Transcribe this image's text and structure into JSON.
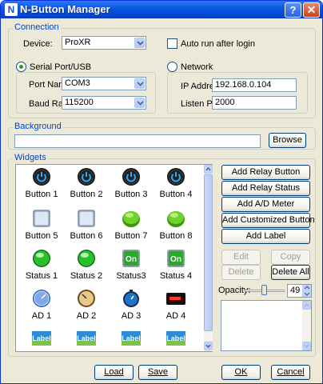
{
  "window": {
    "title": "N-Button Manager",
    "icon_letter": "N"
  },
  "connection": {
    "title": "Connection",
    "device_label": "Device:",
    "device_value": "ProXR",
    "auto_run_label": "Auto run after login",
    "serial_label": "Serial Port/USB",
    "network_label": "Network",
    "port_name_label": "Port Name:",
    "port_name_value": "COM3",
    "baud_rate_label": "Baud Rate:",
    "baud_rate_value": "115200",
    "ip_label": "IP Address:",
    "ip_value": "192.168.0.104",
    "listen_port_label": "Listen Port:",
    "listen_port_value": "2000"
  },
  "background": {
    "title": "Background",
    "path_value": "",
    "browse_label": "Browse"
  },
  "widgets": {
    "title": "Widgets",
    "items": [
      {
        "label": "Button 1",
        "icon": "power-button-icon"
      },
      {
        "label": "Button 2",
        "icon": "power-button-icon"
      },
      {
        "label": "Button 3",
        "icon": "power-button-icon"
      },
      {
        "label": "Button 4",
        "icon": "power-button-icon"
      },
      {
        "label": "Button 5",
        "icon": "square-button-icon"
      },
      {
        "label": "Button 6",
        "icon": "square-button-icon"
      },
      {
        "label": "Button 7",
        "icon": "green-round-button-icon"
      },
      {
        "label": "Button 8",
        "icon": "green-round-button-icon"
      },
      {
        "label": "Status 1",
        "icon": "green-led-icon"
      },
      {
        "label": "Status 2",
        "icon": "green-led-icon"
      },
      {
        "label": "Status3",
        "icon": "on-status-icon"
      },
      {
        "label": "Status 4",
        "icon": "on-status-icon"
      },
      {
        "label": "AD 1",
        "icon": "blue-meter-icon"
      },
      {
        "label": "AD 2",
        "icon": "gauge-meter-icon"
      },
      {
        "label": "AD 3",
        "icon": "stopwatch-meter-icon"
      },
      {
        "label": "AD 4",
        "icon": "digital-meter-icon"
      },
      {
        "label": "",
        "icon": "label-icon"
      },
      {
        "label": "",
        "icon": "label-icon"
      },
      {
        "label": "",
        "icon": "label-icon"
      },
      {
        "label": "",
        "icon": "label-icon"
      }
    ],
    "on_text": "On",
    "label_icon_text": "Label",
    "add_relay_button": "Add Relay Button",
    "add_relay_status": "Add Relay Status",
    "add_ad_meter": "Add A/D Meter",
    "add_customized_button": "Add Customized Button",
    "add_label": "Add Label",
    "edit": "Edit",
    "copy": "Copy",
    "delete": "Delete",
    "delete_all": "Delete All",
    "opacity_label": "Opacity:",
    "opacity_value": "49"
  },
  "footer": {
    "load": "Load",
    "save": "Save",
    "ok": "OK",
    "cancel": "Cancel"
  },
  "colors": {
    "title_bar": "#0a55e0",
    "group_title": "#0046d5",
    "face": "#ece9d8"
  }
}
